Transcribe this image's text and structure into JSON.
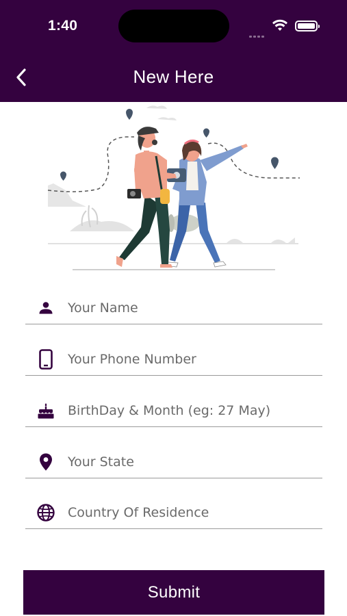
{
  "status_bar": {
    "time": "1:40"
  },
  "header": {
    "title": "New Here"
  },
  "form": {
    "fields": [
      {
        "icon": "person-icon",
        "placeholder": "Your Name",
        "value": ""
      },
      {
        "icon": "phone-icon",
        "placeholder": "Your Phone Number",
        "value": ""
      },
      {
        "icon": "cake-icon",
        "placeholder": "BirthDay & Month (eg: 27 May)",
        "value": ""
      },
      {
        "icon": "location-pin-icon",
        "placeholder": "Your State",
        "value": ""
      },
      {
        "icon": "globe-icon",
        "placeholder": "Country Of Residence",
        "value": ""
      }
    ],
    "submit_label": "Submit"
  },
  "colors": {
    "primary": "#34023f",
    "text_placeholder": "#6a6a6a",
    "divider": "#9a9a9a"
  }
}
